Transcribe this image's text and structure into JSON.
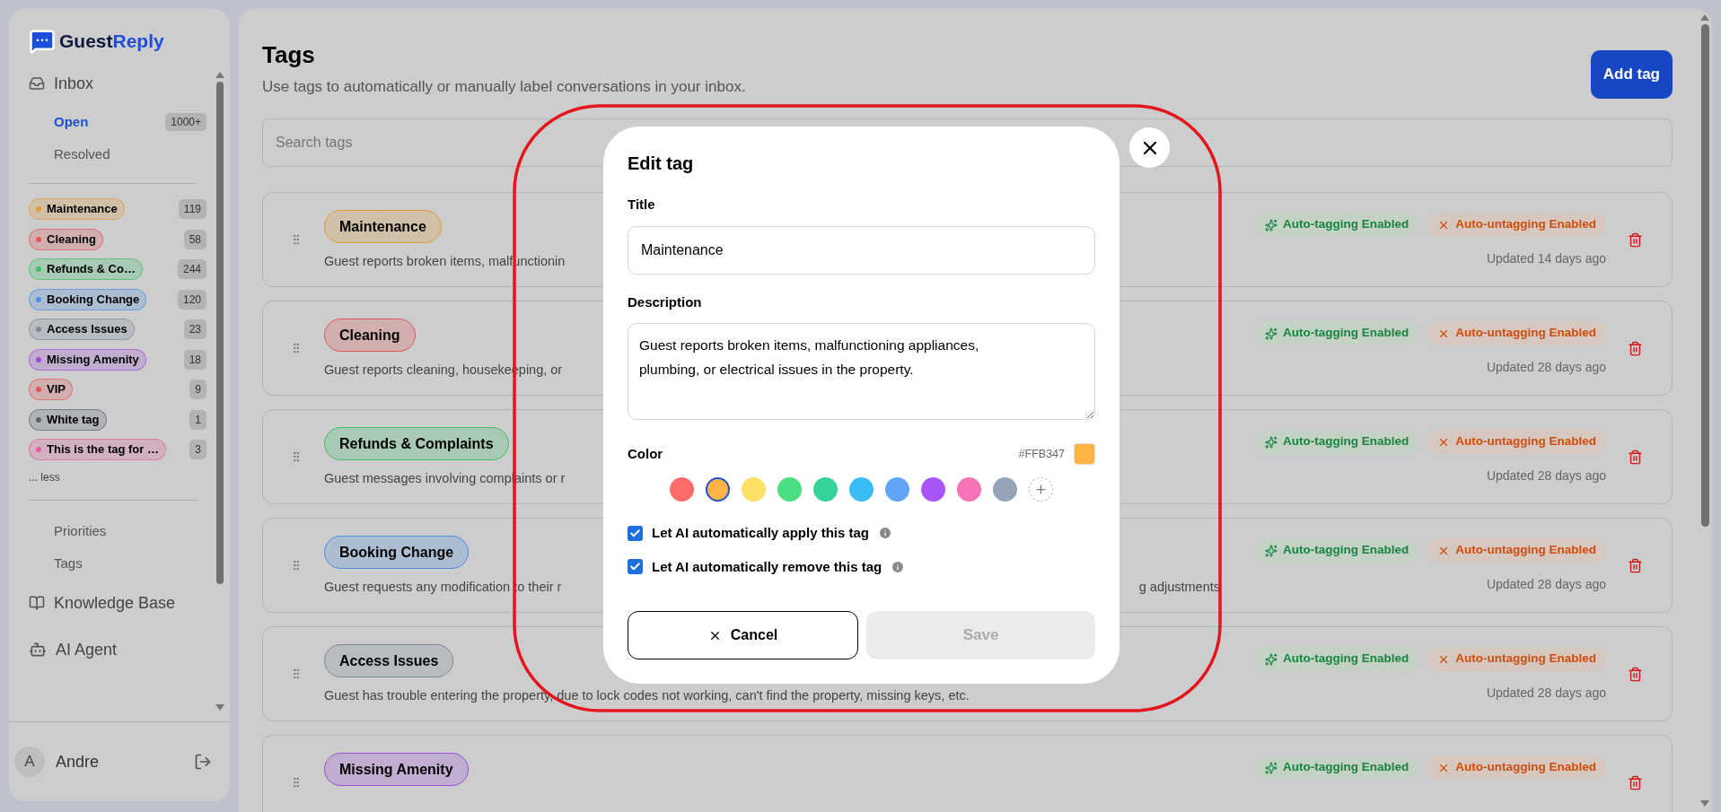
{
  "sidebar": {
    "brand": {
      "part_1": "Guest",
      "part_2": "Reply"
    },
    "inbox": {
      "label": "Inbox",
      "items": [
        {
          "label": "Open",
          "count": "1000+",
          "selected": true
        },
        {
          "label": "Resolved",
          "selected": false
        }
      ]
    },
    "tags": [
      {
        "label": "Maintenance",
        "count": "119",
        "color": "#e09a3a"
      },
      {
        "label": "Cleaning",
        "count": "58",
        "color": "#e05757"
      },
      {
        "label": "Refunds & Co…",
        "count": "244",
        "color": "#3cbf68"
      },
      {
        "label": "Booking Change",
        "count": "120",
        "color": "#4a8ee0"
      },
      {
        "label": "Access Issues",
        "count": "23",
        "color": "#7d8796"
      },
      {
        "label": "Missing Amenity",
        "count": "18",
        "color": "#9a4fd6"
      },
      {
        "label": "VIP",
        "count": "9",
        "color": "#e05757"
      },
      {
        "label": "White tag",
        "count": "1",
        "color": "#5b6372"
      },
      {
        "label": "This is the tag for …",
        "count": "3",
        "color": "#e0609e"
      }
    ],
    "less": "... less",
    "sub_items": [
      "Priorities",
      "Tags"
    ],
    "nav": [
      {
        "label": "Knowledge Base",
        "kind": "book"
      },
      {
        "label": "AI Agent",
        "kind": "robot"
      }
    ],
    "user": {
      "initial": "A",
      "name": "Andre"
    }
  },
  "page": {
    "title": "Tags",
    "subtitle": "Use tags to automatically or manually label conversations in your inbox.",
    "add_button": "Add tag",
    "search": {
      "placeholder": "Search tags"
    },
    "rows": [
      {
        "name": "Maintenance",
        "color": "#e09a3a",
        "description": "Guest reports broken items, malfunctionin",
        "auto_tagging": "Auto-tagging Enabled",
        "auto_untagging": "Auto-untagging Enabled",
        "updated": "Updated 14 days ago"
      },
      {
        "name": "Cleaning",
        "color": "#e05757",
        "description": "Guest reports cleaning, housekeeping, or",
        "auto_tagging": "Auto-tagging Enabled",
        "auto_untagging": "Auto-untagging Enabled",
        "updated": "Updated 28 days ago"
      },
      {
        "name": "Refunds & Complaints",
        "color": "#3cbf68",
        "description": "Guest messages involving complaints or r",
        "auto_tagging": "Auto-tagging Enabled",
        "auto_untagging": "Auto-untagging Enabled",
        "updated": "Updated 28 days ago"
      },
      {
        "name": "Booking Change",
        "color": "#4a8ee0",
        "description": "Guest requests any modification to their r",
        "description_tail": "g adjustments",
        "auto_tagging": "Auto-tagging Enabled",
        "auto_untagging": "Auto-untagging Enabled",
        "updated": "Updated 28 days ago"
      },
      {
        "name": "Access Issues",
        "color": "#7d8796",
        "description": "Guest has trouble entering the property, due to lock codes not working, can't find the property, missing keys, etc.",
        "auto_tagging": "Auto-tagging Enabled",
        "auto_untagging": "Auto-untagging Enabled",
        "updated": "Updated 28 days ago"
      },
      {
        "name": "Missing Amenity",
        "color": "#9a4fd6",
        "auto_tagging": "Auto-tagging Enabled",
        "auto_untagging": "Auto-untagging Enabled"
      }
    ]
  },
  "modal": {
    "title": "Edit tag",
    "title_label": "Title",
    "title_value": "Maintenance",
    "description_label": "Description",
    "description_value": "Guest reports broken items, malfunctioning appliances, plumbing, or electrical issues in the property.",
    "color_label": "Color",
    "color_hex": "#FFB347",
    "swatches": [
      {
        "color": "#ff6b6b",
        "selected": false
      },
      {
        "color": "#ffb347",
        "selected": true
      },
      {
        "color": "#ffe066",
        "selected": false
      },
      {
        "color": "#4ade80",
        "selected": false
      },
      {
        "color": "#34d399",
        "selected": false
      },
      {
        "color": "#38bdf8",
        "selected": false
      },
      {
        "color": "#60a5fa",
        "selected": false
      },
      {
        "color": "#a855f7",
        "selected": false
      },
      {
        "color": "#f472b6",
        "selected": false
      },
      {
        "color": "#94a3b8",
        "selected": false
      }
    ],
    "options": [
      {
        "label": "Let AI automatically apply this tag",
        "checked": true
      },
      {
        "label": "Let AI automatically remove this tag",
        "checked": true
      }
    ],
    "cancel": "Cancel",
    "save": "Save",
    "save_disabled": true
  }
}
